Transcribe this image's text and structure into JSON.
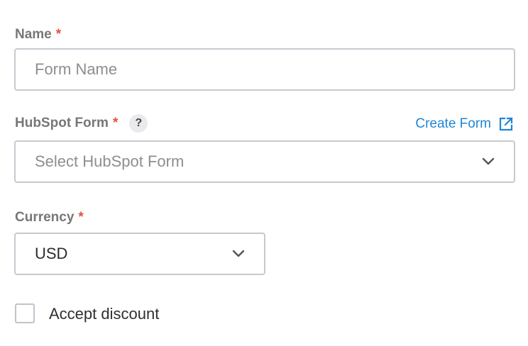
{
  "name_field": {
    "label": "Name",
    "required_mark": "*",
    "placeholder": "Form Name"
  },
  "hubspot_field": {
    "label": "HubSpot Form",
    "required_mark": "*",
    "help_symbol": "?",
    "create_link": "Create Form",
    "create_link_icon": "external-link-icon",
    "placeholder": "Select HubSpot Form",
    "dropdown_icon": "chevron-down-icon"
  },
  "currency_field": {
    "label": "Currency",
    "required_mark": "*",
    "value": "USD",
    "dropdown_icon": "chevron-down-icon"
  },
  "discount": {
    "label": "Accept discount",
    "checked": false
  },
  "colors": {
    "required": "#e0533d",
    "link": "#1f86d6",
    "border": "#c8c8d0",
    "label": "#777777"
  }
}
